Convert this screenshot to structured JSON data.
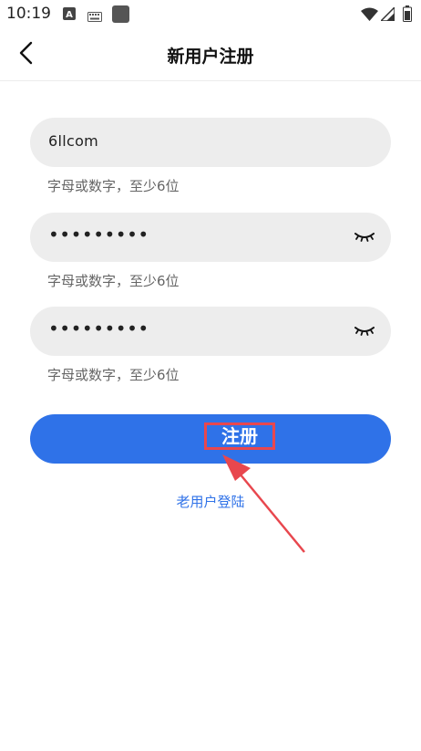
{
  "status_bar": {
    "time": "10:19",
    "icons": [
      "a-badge-icon",
      "keyboard-icon",
      "app-square-icon",
      "wifi-icon",
      "signal-icon",
      "battery-icon"
    ]
  },
  "header": {
    "title": "新用户注册",
    "back_icon": "chevron-left-icon"
  },
  "form": {
    "username": {
      "value": "6llcom",
      "hint": "字母或数字，至少6位"
    },
    "password": {
      "value": "•••••••••",
      "hint": "字母或数字，至少6位",
      "eye_icon": "eye-closed-icon"
    },
    "confirm_password": {
      "value": "•••••••••",
      "hint": "字母或数字，至少6位",
      "eye_icon": "eye-closed-icon"
    },
    "submit_label": "注册",
    "login_link": "老用户登陆"
  },
  "colors": {
    "accent": "#2f72e8",
    "field_bg": "#ededed",
    "annotation": "#e8474e"
  }
}
